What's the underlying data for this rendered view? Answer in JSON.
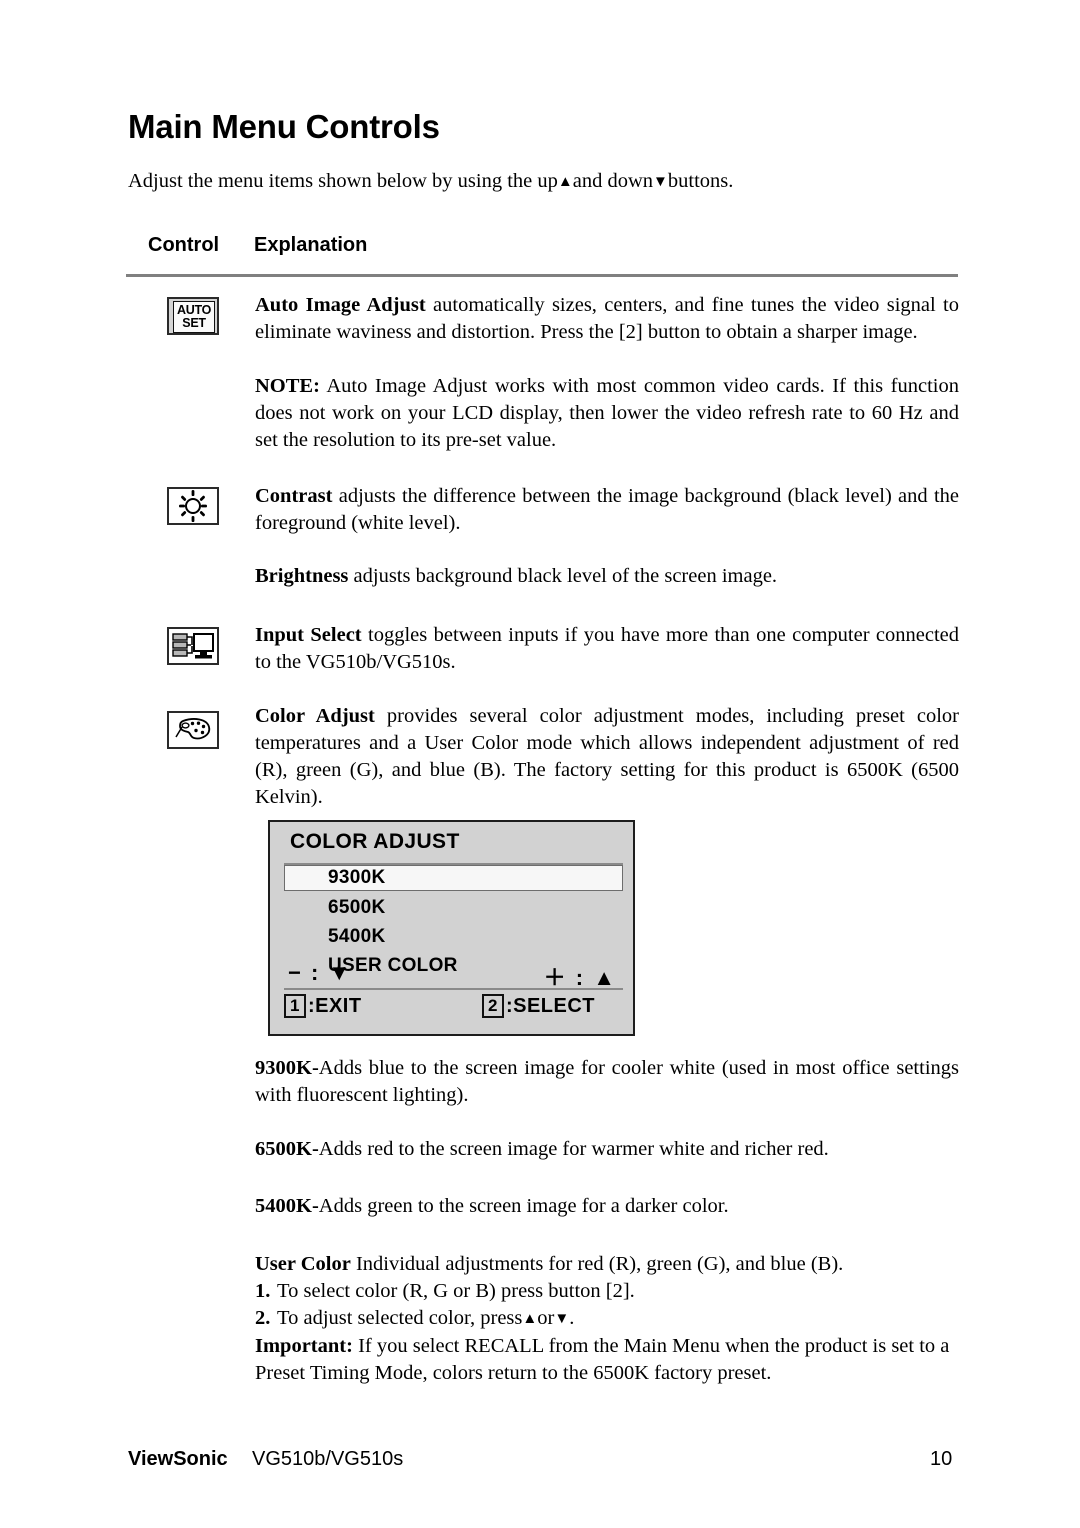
{
  "document": {
    "title": "Main Menu Controls",
    "intro_prefix": "Adjust the menu items shown below by using the up",
    "intro_middle": "and down",
    "intro_suffix": "buttons.",
    "columns": {
      "control": "Control",
      "explanation": "Explanation"
    }
  },
  "icons": {
    "autoset": {
      "line1": "AUTO",
      "line2": "SET",
      "name": "auto-set-icon"
    },
    "contrast": {
      "name": "contrast-sun-icon"
    },
    "input_select": {
      "name": "input-select-monitor-icon"
    },
    "color_adjust": {
      "name": "color-palette-icon"
    }
  },
  "entries": {
    "auto_image_adjust": {
      "term": "Auto Image Adjust",
      "body": " automatically sizes, centers, and fine tunes the video signal to eliminate waviness and distortion. Press the [2] button to obtain a sharper image."
    },
    "note": {
      "term": "NOTE:",
      "body": " Auto Image Adjust works with most common video cards. If this function does not work on your LCD display, then lower the video refresh rate to 60 Hz and set the resolution to its pre-set value."
    },
    "contrast": {
      "term": "Contrast",
      "body": " adjusts the difference between the image background  (black level) and the foreground (white level)."
    },
    "brightness": {
      "term": "Brightness",
      "body": " adjusts background black level of the screen image."
    },
    "input_select": {
      "term": "Input Select",
      "body": " toggles between inputs if you have more than one computer connected to the VG510b/VG510s."
    },
    "color_adjust": {
      "term": "Color Adjust",
      "body": " provides several color adjustment modes, including preset color temperatures and a User Color mode which allows independent adjustment of red (R), green (G), and blue (B). The factory setting for this product is 6500K (6500 Kelvin)."
    },
    "k9300": {
      "term": "9300K-",
      "body": "Adds blue to the screen image for cooler white (used in most office settings with fluorescent lighting)."
    },
    "k6500": {
      "term": "6500K-",
      "body": "Adds red to the screen image for warmer white and richer red."
    },
    "k5400": {
      "term": "5400K-",
      "body": "Adds green to the screen image for a darker color."
    },
    "user_color": {
      "term": "User Color",
      "body": "  Individual adjustments for red (R), green (G),  and blue (B).",
      "step1_num": "1.",
      "step1_text": "To select color (R, G or B) press button [2].",
      "step2_num": "2.",
      "step2_text_a": "To adjust selected color, press",
      "step2_text_b": "or",
      "step2_text_c": ".",
      "important_term": "Important:",
      "important_body": " If you select RECALL from the Main Menu when the product is set to a Preset Timing Mode, colors return to the 6500K factory preset."
    }
  },
  "osd": {
    "title": "COLOR ADJUST",
    "items": [
      {
        "label": "9300K",
        "selected": true
      },
      {
        "label": "6500K",
        "selected": false
      },
      {
        "label": "5400K",
        "selected": false
      },
      {
        "label": "USER COLOR",
        "selected": false
      }
    ],
    "minus_hint": "− : ▼",
    "plus_hint": "＋ : ▲",
    "exit_key": "1",
    "exit_label": ":EXIT",
    "select_key": "2",
    "select_label": ":SELECT",
    "colors": {
      "background": "#d2d2d2",
      "border": "#1d1d1d",
      "highlight": "#f7f7f7",
      "rule": "#8a8a8a"
    }
  },
  "footer": {
    "brand": "ViewSonic",
    "model": "VG510b/VG510s",
    "page_number": "10"
  }
}
